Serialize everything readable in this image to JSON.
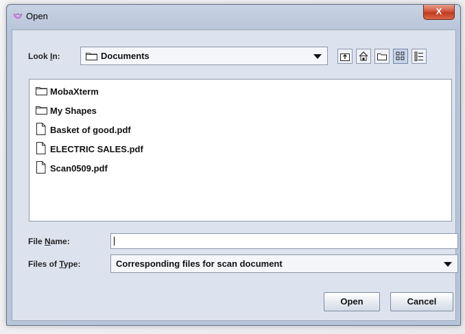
{
  "window": {
    "title": "Open",
    "close_glyph": "X"
  },
  "toolbar": {
    "look_in_label_pre": "Look ",
    "look_in_label_mnemonic": "I",
    "look_in_label_post": "n:",
    "look_in_value": "Documents",
    "icons": [
      "up-one-level-icon",
      "home-icon",
      "new-folder-icon",
      "list-view-icon",
      "details-view-icon"
    ]
  },
  "files": [
    {
      "name": "MobaXterm",
      "type": "folder"
    },
    {
      "name": "My Shapes",
      "type": "folder"
    },
    {
      "name": "Basket of good.pdf",
      "type": "file"
    },
    {
      "name": "ELECTRIC SALES.pdf",
      "type": "file"
    },
    {
      "name": "Scan0509.pdf",
      "type": "file"
    }
  ],
  "form": {
    "file_name_label_pre": "File ",
    "file_name_label_mnemonic": "N",
    "file_name_label_post": "ame:",
    "file_name_value": "",
    "files_of_type_label_pre": "Files of ",
    "files_of_type_label_mnemonic": "T",
    "files_of_type_label_post": "ype:",
    "files_of_type_value": "Corresponding files for scan document"
  },
  "buttons": {
    "open": "Open",
    "cancel": "Cancel"
  },
  "colors": {
    "dialog_bg": "#dde3ee",
    "title_bg": "#c8d2e2",
    "close_red": "#c0391f"
  }
}
